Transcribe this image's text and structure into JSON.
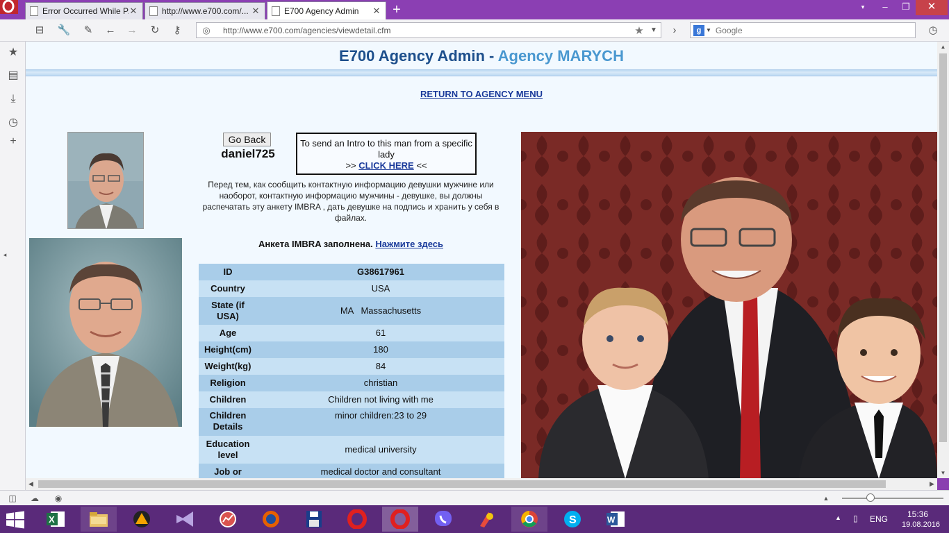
{
  "browser": {
    "tabs": [
      {
        "title": "Error Occurred While P...",
        "active": false
      },
      {
        "title": "http://www.e700.com/...",
        "active": false
      },
      {
        "title": "E700 Agency Admin",
        "active": true
      }
    ],
    "address": "http://www.e700.com/agencies/viewdetail.cfm",
    "search_engine": "Google",
    "search_placeholder": "Google"
  },
  "page": {
    "title": "E700 Agency Admin - ",
    "agency": "Agency MARYCH",
    "return_link": "RETURN TO AGENCY MENU",
    "go_back": "Go Back",
    "username": "daniel725",
    "intro": {
      "text": "To send an Intro to this man from a specific lady",
      "prefix": ">> ",
      "link": "CLICK HERE",
      "suffix": " <<"
    },
    "russian_notice": "Перед тем, как сообщить контактную информацию девушки мужчине или наоборот, контактную информацию мужчины - девушке, вы должны распечатать эту анкету IMBRA , дать девушке на подпись и хранить у себя в файлах.",
    "imbra_text": "Анкета IMBRA заполнена. ",
    "imbra_link": "Нажмите здесь",
    "profile": [
      {
        "label": "ID",
        "value": "G38617961"
      },
      {
        "label": "Country",
        "value": "USA"
      },
      {
        "label": "State (if USA)",
        "value": "MA   Massachusetts"
      },
      {
        "label": "Age",
        "value": "61"
      },
      {
        "label": "Height(cm)",
        "value": "180"
      },
      {
        "label": "Weight(kg)",
        "value": "84"
      },
      {
        "label": "Religion",
        "value": "christian"
      },
      {
        "label": "Children",
        "value": "Children not living with me"
      },
      {
        "label": "Children Details",
        "value": "minor children:23 to 29"
      },
      {
        "label": "Education level",
        "value": "medical university"
      },
      {
        "label": "Job or",
        "value": "medical doctor and consultant"
      }
    ]
  },
  "taskbar": {
    "lang": "ENG",
    "time": "15:36",
    "date": "19.08.2016"
  },
  "colors": {
    "tabstrip": "#8b3fb3",
    "title_blue": "#1d4f8c",
    "agency_blue": "#4a98d0",
    "row_dark": "#a9cde9",
    "row_light": "#c7e1f4",
    "link": "#1a3a9a"
  }
}
